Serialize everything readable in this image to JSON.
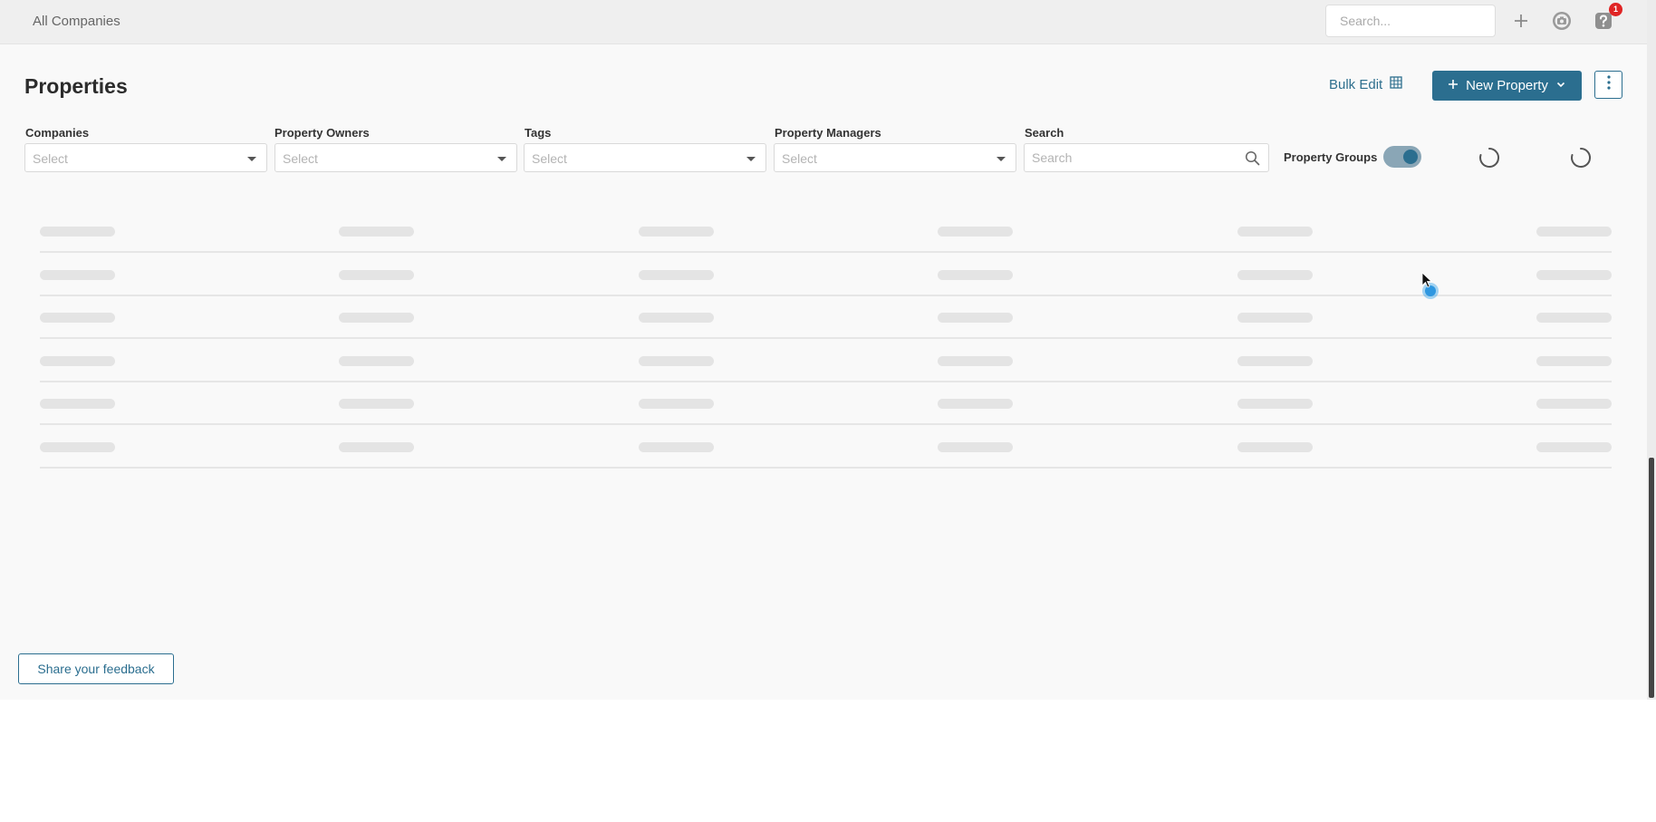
{
  "topbar": {
    "breadcrumb": "All Companies",
    "search_placeholder": "Search...",
    "notification_count": "1",
    "icons": [
      "plus-icon",
      "camera-icon",
      "help-icon"
    ]
  },
  "page": {
    "title": "Properties",
    "bulk_edit_label": "Bulk Edit",
    "new_property_label": "New Property"
  },
  "filters": {
    "companies": {
      "label": "Companies",
      "placeholder": "Select"
    },
    "property_owners": {
      "label": "Property Owners",
      "placeholder": "Select"
    },
    "tags": {
      "label": "Tags",
      "placeholder": "Select"
    },
    "property_managers": {
      "label": "Property Managers",
      "placeholder": "Select"
    },
    "search": {
      "label": "Search",
      "placeholder": "Search"
    },
    "property_groups": {
      "label": "Property Groups",
      "enabled": true
    }
  },
  "table": {
    "state": "loading",
    "skeleton_rows": 6,
    "skeleton_columns": 6
  },
  "footer": {
    "feedback_label": "Share your feedback"
  },
  "colors": {
    "accent": "#2b6e8f",
    "badge": "#e02424",
    "skeleton": "#e4e4e4"
  }
}
